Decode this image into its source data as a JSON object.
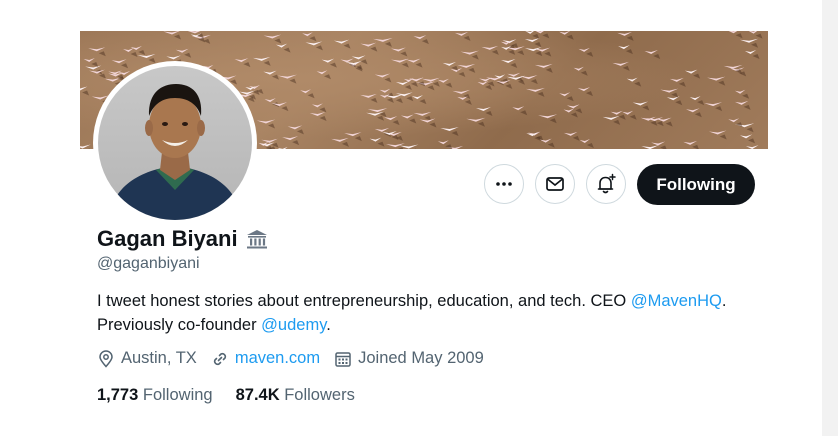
{
  "profile": {
    "display_name": "Gagan Biyani",
    "handle": "@gaganbiyani",
    "bio_text_1": "I tweet honest stories about entrepreneurship, education, and tech. CEO ",
    "bio_mention_1": "@MavenHQ",
    "bio_text_2": ". Previously co-founder ",
    "bio_mention_2": "@udemy",
    "bio_text_3": "."
  },
  "meta": {
    "location": "Austin, TX",
    "website": "maven.com",
    "joined": "Joined May 2009"
  },
  "stats": {
    "following_count": "1,773",
    "following_label": "Following",
    "followers_count": "87.4K",
    "followers_label": "Followers"
  },
  "actions": {
    "follow_label": "Following"
  },
  "icons": {
    "more": "more-icon",
    "message": "envelope-icon",
    "notify": "bell-plus-icon",
    "affiliation": "government-building-icon",
    "location": "location-pin-icon",
    "link": "link-icon",
    "calendar": "calendar-icon"
  },
  "colors": {
    "accent": "#1d9bf0",
    "text": "#0f1419",
    "muted": "#536471",
    "button_dark": "#0f1419",
    "border": "#cfd9de"
  }
}
